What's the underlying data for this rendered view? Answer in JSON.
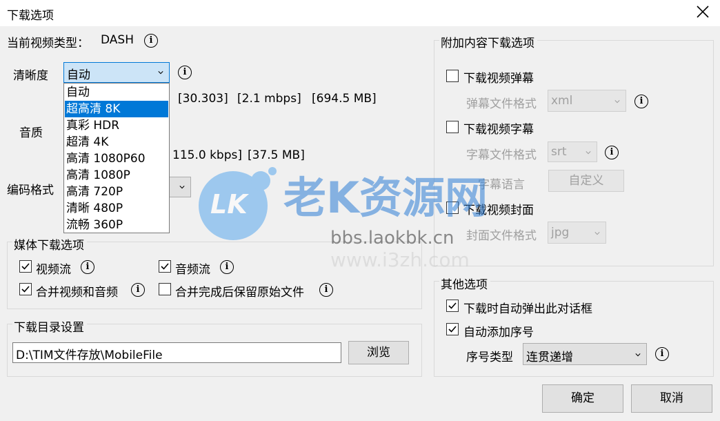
{
  "window": {
    "title": "下载选项"
  },
  "video_type": {
    "label": "当前视频类型：",
    "value": "DASH"
  },
  "quality": {
    "label": "清晰度",
    "selected": "自动",
    "options": [
      "自动",
      "超高清 8K",
      "真彩 HDR",
      "超清 4K",
      "高清 1080P60",
      "高清 1080P",
      "高清 720P",
      "清晰 480P",
      "流畅 360P"
    ],
    "highlighted": "超高清 8K",
    "info_fps": "[30.303]",
    "info_bitrate": "[2.1 mbps]",
    "info_size": "[694.5 MB]"
  },
  "audio": {
    "label": "音质",
    "info_bitrate": "115.0 kbps]",
    "info_size": "[37.5 MB]"
  },
  "codec": {
    "label": "编码格式"
  },
  "media_download": {
    "title": "媒体下载选项",
    "video_stream": {
      "label": "视频流",
      "checked": true
    },
    "audio_stream": {
      "label": "音频流",
      "checked": true
    },
    "merge": {
      "label": "合并视频和音频",
      "checked": true
    },
    "keep_original": {
      "label": "合并完成后保留原始文件",
      "checked": false
    }
  },
  "directory": {
    "title": "下载目录设置",
    "path": "D:\\TIM文件存放\\MobileFile",
    "browse": "浏览"
  },
  "extra": {
    "title": "附加内容下载选项",
    "danmaku": {
      "label": "下载视频弹幕",
      "checked": false,
      "format_label": "弹幕文件格式",
      "format": "xml"
    },
    "subtitle": {
      "label": "下载视频字幕",
      "checked": false,
      "format_label": "字幕文件格式",
      "format": "srt",
      "lang_label": "字幕语言",
      "lang_button": "自定义"
    },
    "cover": {
      "label": "下载视频封面",
      "checked": false,
      "format_label": "封面文件格式",
      "format": "jpg"
    }
  },
  "other": {
    "title": "其他选项",
    "auto_popup": {
      "label": "下载时自动弹出此对话框",
      "checked": true
    },
    "auto_number": {
      "label": "自动添加序号",
      "checked": true
    },
    "number_type_label": "序号类型",
    "number_type": "连贯递增"
  },
  "buttons": {
    "ok": "确定",
    "cancel": "取消"
  },
  "watermark": {
    "logo": "LK",
    "text": "老K资源网",
    "url1": "bbs.laokbk.cn",
    "url2": "www.i3zh.com"
  },
  "colors": {
    "selection": "#0078d7",
    "window_bg": "#f0f0f0",
    "watermark": "#2f7fd6"
  }
}
